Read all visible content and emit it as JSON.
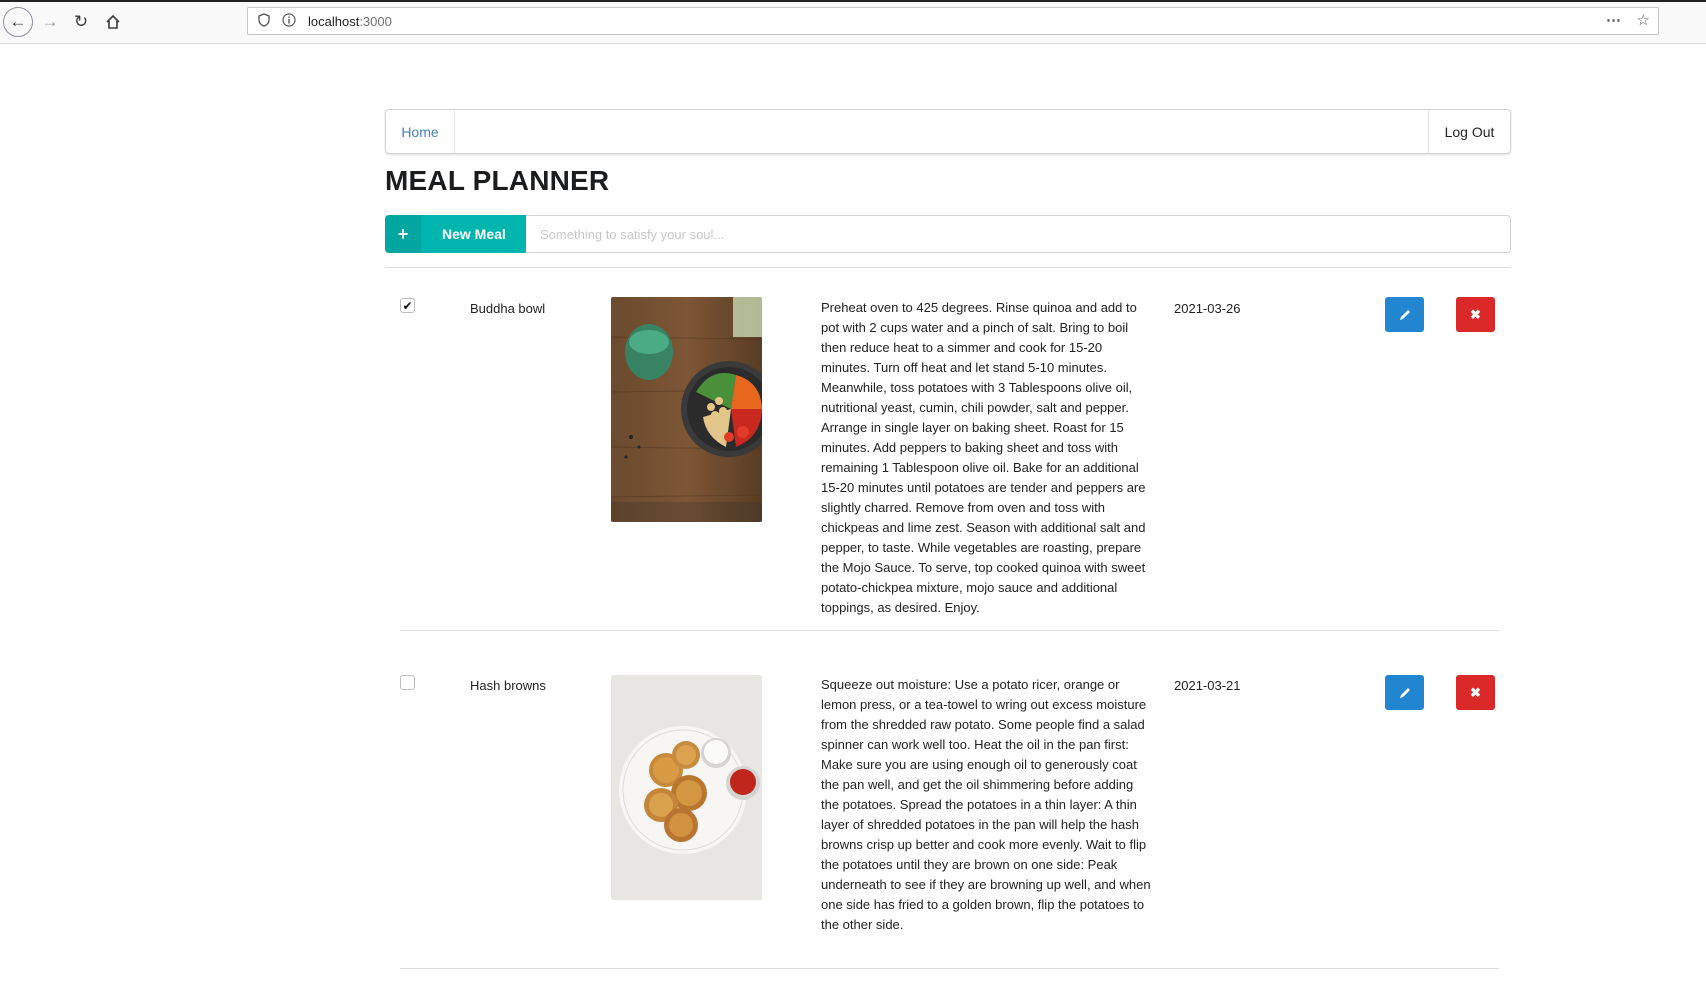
{
  "browser": {
    "url_host": "localhost",
    "url_port": ":3000"
  },
  "nav": {
    "home_label": "Home",
    "logout_label": "Log Out"
  },
  "page_title": "MEAL PLANNER",
  "new_meal": {
    "button_label": "New Meal",
    "placeholder": "Something to satisfy your soul..."
  },
  "meals": [
    {
      "checked": true,
      "name": "Buddha bowl",
      "image": "buddha-bowl-photo",
      "description": "Preheat oven to 425 degrees. Rinse quinoa and add to pot with 2 cups water and a pinch of salt. Bring to boil then reduce heat to a simmer and cook for 15-20 minutes. Turn off heat and let stand 5-10 minutes. Meanwhile, toss potatoes with 3 Tablespoons olive oil, nutritional yeast, cumin, chili powder, salt and pepper. Arrange in single layer on baking sheet. Roast for 15 minutes. Add peppers to baking sheet and toss with remaining 1 Tablespoon olive oil. Bake for an additional 15-20 minutes until potatoes are tender and peppers are slightly charred. Remove from oven and toss with chickpeas and lime zest. Season with additional salt and pepper, to taste. While vegetables are roasting, prepare the Mojo Sauce. To serve, top cooked quinoa with sweet potato-chickpea mixture, mojo sauce and additional toppings, as desired. Enjoy.",
      "date": "2021-03-26"
    },
    {
      "checked": false,
      "name": "Hash browns",
      "image": "hash-browns-photo",
      "description": "Squeeze out moisture: Use a potato ricer, orange or lemon press, or a tea-towel to wring out excess moisture from the shredded raw potato. Some people find a salad spinner can work well too. Heat the oil in the pan first: Make sure you are using enough oil to generously coat the pan well, and get the oil shimmering before adding the potatoes. Spread the potatoes in a thin layer: A thin layer of shredded potatoes in the pan will help the hash browns crisp up better and cook more evenly. Wait to flip the potatoes until they are brown on one side: Peak underneath to see if they are browning up well, and when one side has fried to a golden brown, flip the potatoes to the other side.",
      "date": "2021-03-21"
    }
  ],
  "icons": {
    "add": "plus-icon",
    "edit": "pencil-icon",
    "delete": "x-icon"
  },
  "colors": {
    "teal": "#00b5ad",
    "blue": "#2185d0",
    "red": "#db2828",
    "link": "#4183c4"
  }
}
